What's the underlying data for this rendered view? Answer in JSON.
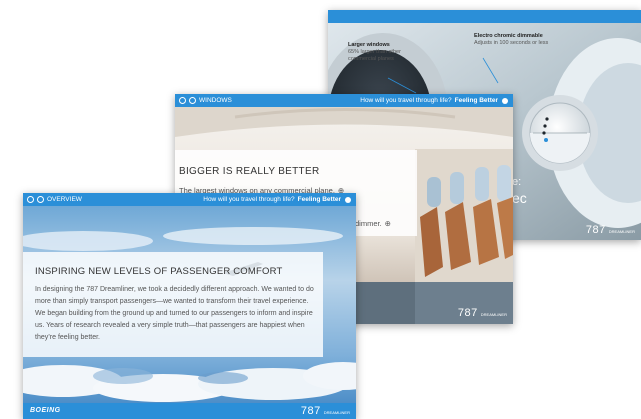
{
  "back_panel": {
    "callout_left_title": "Larger windows",
    "callout_left_text1": "65% larger than other",
    "callout_left_text2": "commercial planes",
    "callout_right_title": "Electro chromic dimmable",
    "callout_right_text": "Adjusts in 100 seconds or less",
    "partial_text1": "e:",
    "partial_text2": "ec",
    "brand": "787",
    "brand_sub": "DREAMLINER"
  },
  "mid_panel": {
    "section_label": "WINDOWS",
    "tagline": "How will you travel through life?",
    "tagline_bold": "Feeling Better",
    "heading": "BIGGER IS REALLY BETTER",
    "line1": "The largest windows on any commercial plane.",
    "line2": "dimmer.",
    "brand": "787",
    "brand_sub": "DREAMLINER"
  },
  "front_panel": {
    "section_label": "OVERVIEW",
    "tagline": "How will you travel through life?",
    "tagline_bold": "Feeling Better",
    "heading": "INSPIRING NEW LEVELS OF PASSENGER COMFORT",
    "body": "In designing the 787 Dreamliner, we took a decidedly different approach. We wanted to do more than simply transport passengers—we wanted to transform their travel experience. We began building from the ground up and turned to our passengers to inform and inspire us. Years of research revealed a very simple truth—that passengers are happiest when they’re feeling better.",
    "logo": "BOEING",
    "brand": "787",
    "brand_sub": "DREAMLINER"
  },
  "colors": {
    "bar_blue": "#2b8fd8",
    "sky_blue": "#4a8fc8",
    "seat_brown": "#a8653a"
  }
}
